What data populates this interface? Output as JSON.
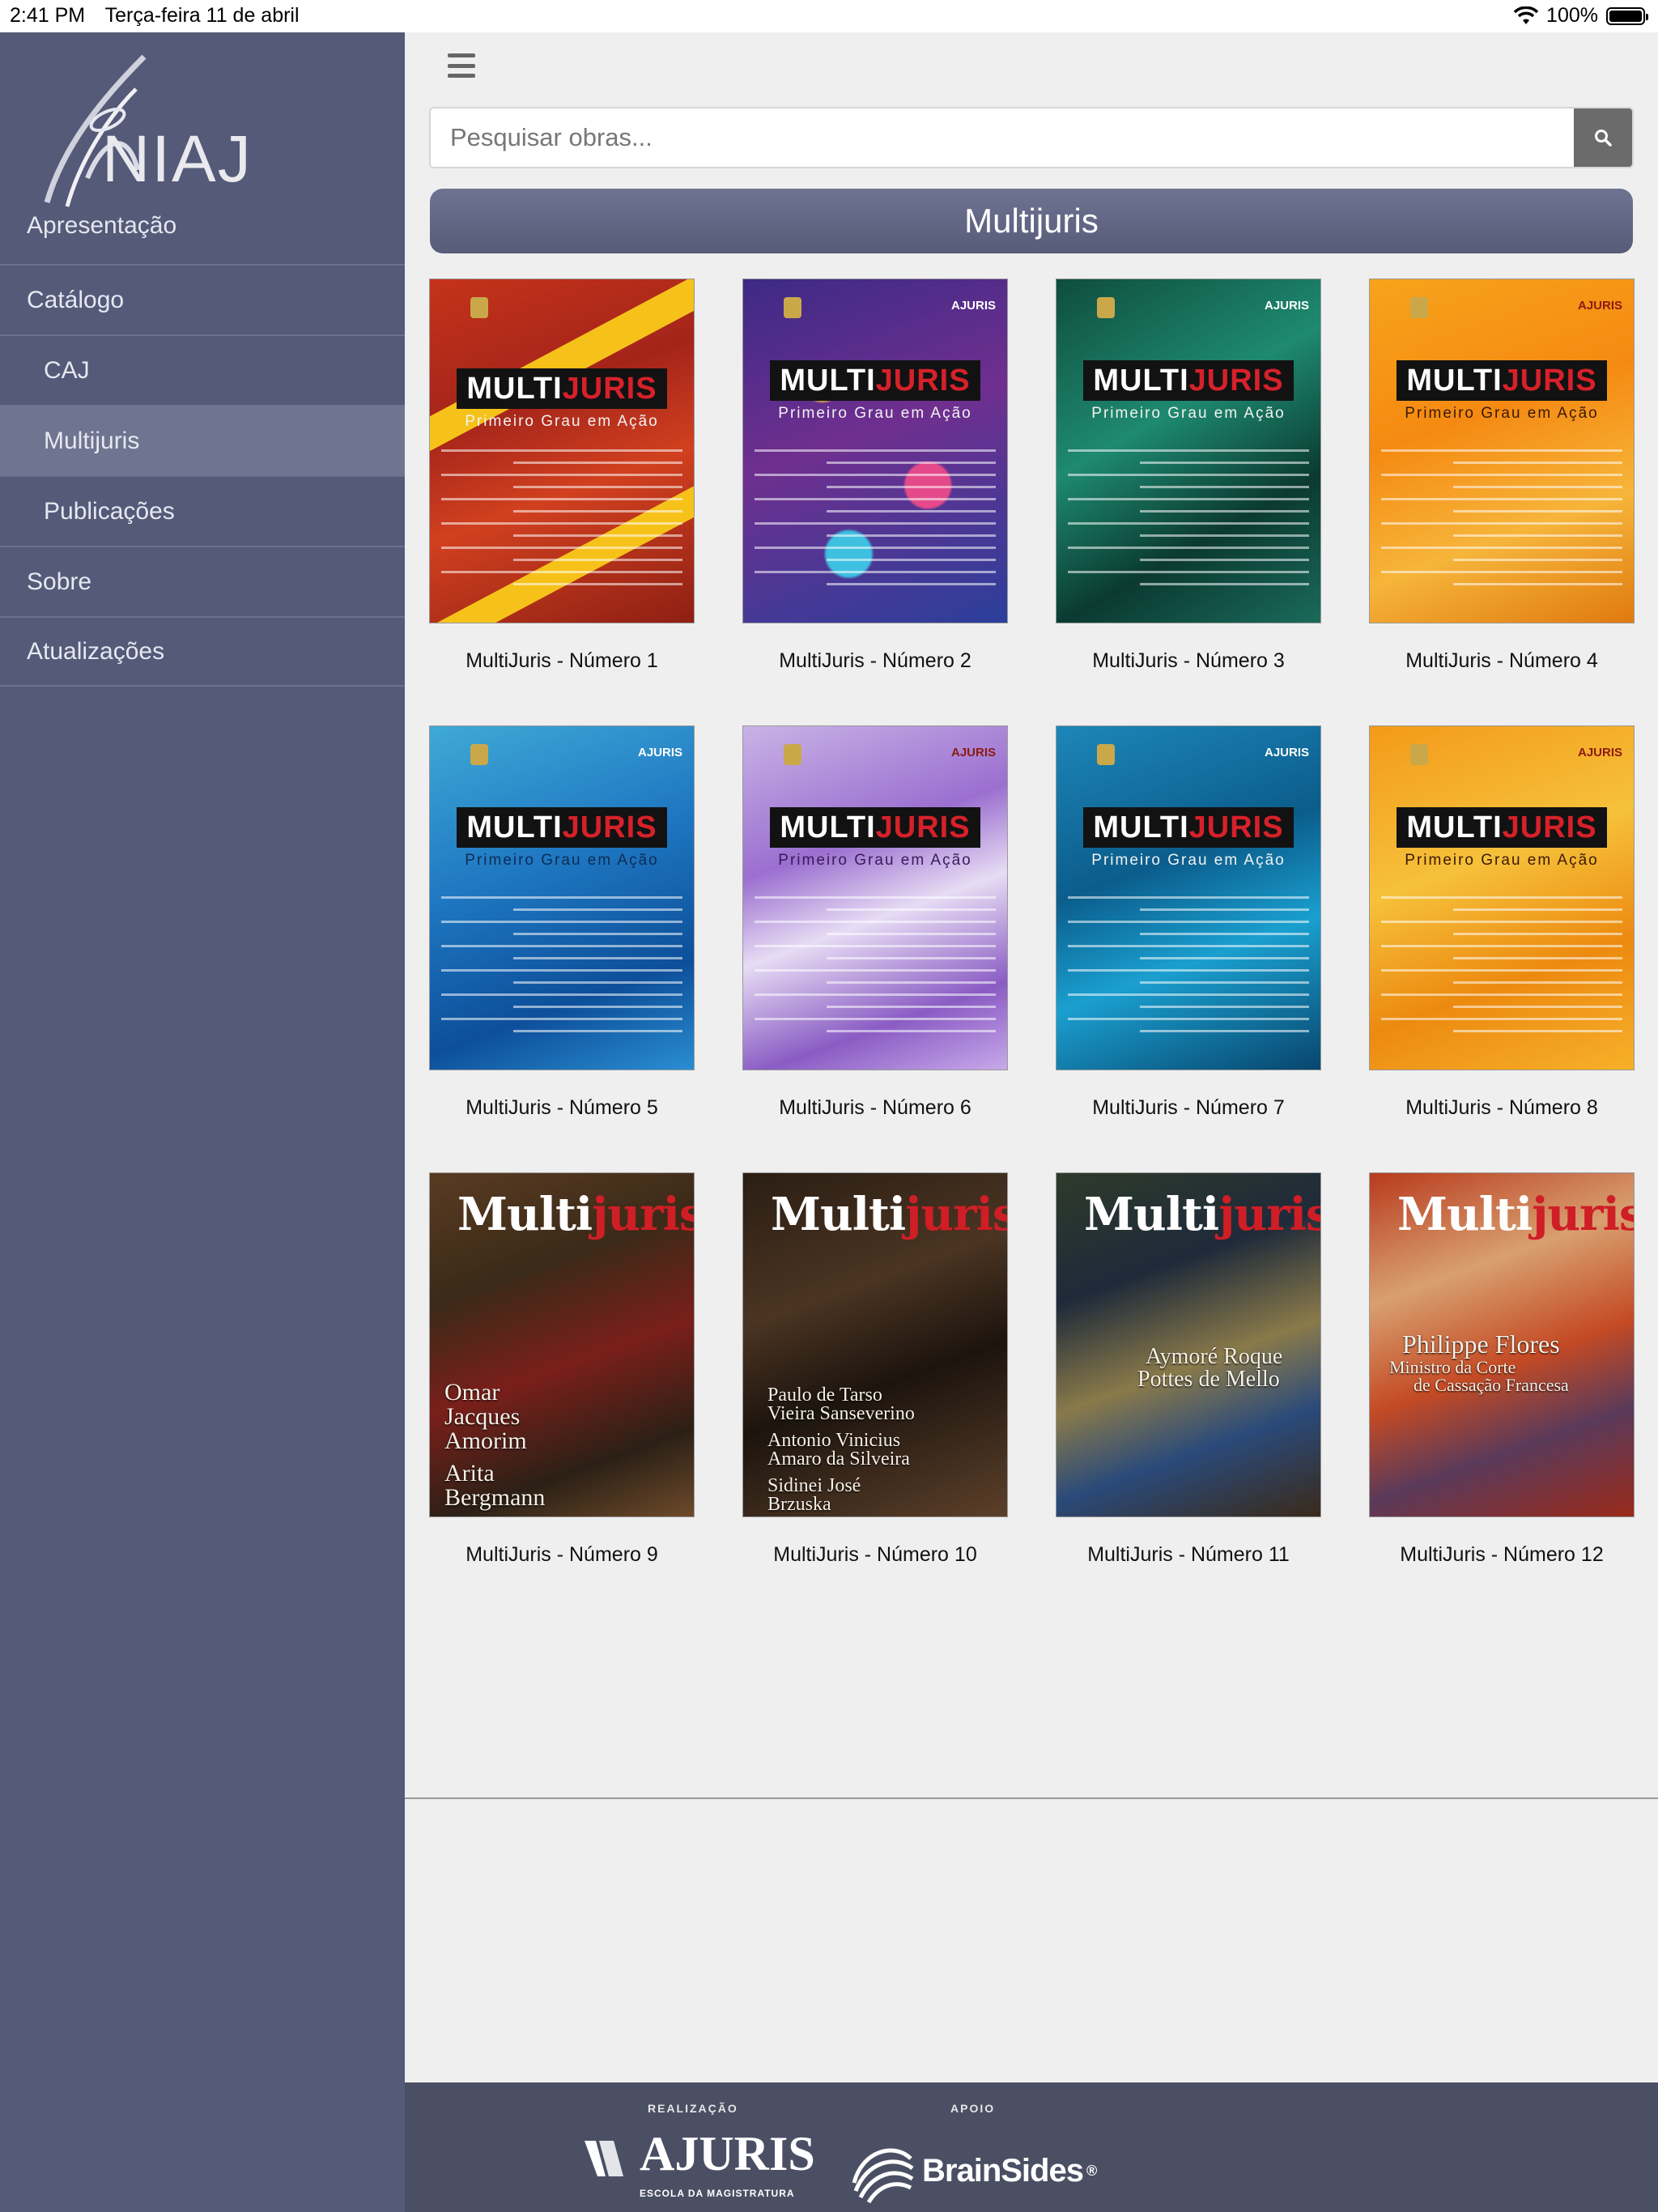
{
  "status": {
    "time": "2:41 PM",
    "date": "Terça-feira 11 de abril",
    "battery": "100%"
  },
  "sidebar": {
    "logo_text": "NIAJ",
    "intro": "Apresentação",
    "items": [
      {
        "label": "Catálogo"
      },
      {
        "label": "CAJ"
      },
      {
        "label": "Multijuris"
      },
      {
        "label": "Publicações"
      },
      {
        "label": "Sobre"
      },
      {
        "label": "Atualizações"
      }
    ]
  },
  "search": {
    "placeholder": "Pesquisar obras..."
  },
  "section": {
    "title": "Multijuris"
  },
  "covers": {
    "band_a": "MULTI",
    "band_b": "JURIS",
    "subtitle": "Primeiro Grau em Ação",
    "classic_a": "Multi",
    "classic_b": "juris",
    "ajuris": "AJURIS"
  },
  "issues": [
    {
      "title": "MultiJuris - Número 1"
    },
    {
      "title": "MultiJuris - Número 2"
    },
    {
      "title": "MultiJuris - Número 3"
    },
    {
      "title": "MultiJuris - Número 4"
    },
    {
      "title": "MultiJuris - Número 5"
    },
    {
      "title": "MultiJuris - Número 6"
    },
    {
      "title": "MultiJuris - Número 7"
    },
    {
      "title": "MultiJuris - Número 8"
    },
    {
      "title": "MultiJuris - Número 9",
      "cover_names": [
        "Omar",
        "Jacques",
        "Amorim",
        "Arita",
        "Bergmann"
      ]
    },
    {
      "title": "MultiJuris - Número 10",
      "cover_names": [
        "Paulo de Tarso",
        "Vieira Sanseverino",
        "Antonio Vinicius",
        "Amaro da Silveira",
        "Sidinei José",
        "Brzuska"
      ]
    },
    {
      "title": "MultiJuris - Número 11",
      "cover_names": [
        "Aymoré Roque",
        "Pottes de Mello"
      ]
    },
    {
      "title": "MultiJuris - Número 12",
      "cover_names": [
        "Philippe Flores",
        "Ministro da Corte",
        "de Cassação Francesa"
      ]
    }
  ],
  "footer": {
    "realizacao": "REALIZAÇÃO",
    "apoio": "APOIO",
    "ajuris": "AJURIS",
    "ajuris_sub": "ESCOLA DA MAGISTRATURA",
    "brainsides": "BrainSides",
    "registered": "®"
  }
}
